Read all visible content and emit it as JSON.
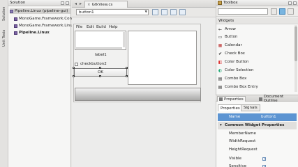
{
  "left_dock": {
    "tabs": [
      "Solution",
      "Unit Tests"
    ]
  },
  "solution": {
    "title": "Solution",
    "items": [
      {
        "label": "Pipeline.Linux (pipeline-gui)",
        "kind": "solution"
      },
      {
        "label": "MonoGame.Framework.Con",
        "kind": "project"
      },
      {
        "label": "MonoGame.Framework.Linu",
        "kind": "project"
      },
      {
        "label": "Pipeline.Linux",
        "kind": "project"
      }
    ]
  },
  "document": {
    "tab_label": "GtkView.cs",
    "widget_combo": "button1"
  },
  "designer": {
    "menu": [
      "File",
      "Edit",
      "Build",
      "Help"
    ],
    "label1": "label1",
    "checkbutton": "checkbutton2",
    "ok": "OK"
  },
  "toolbox": {
    "title": "Toolbox",
    "section": "Widgets",
    "items": [
      {
        "label": "Arrow",
        "icon": "arrow-icon",
        "glyph": "←"
      },
      {
        "label": "Button",
        "icon": "button-icon",
        "glyph": "▭"
      },
      {
        "label": "Calendar",
        "icon": "calendar-icon",
        "glyph": "▦"
      },
      {
        "label": "Check Box",
        "icon": "checkbox-icon",
        "glyph": "✔"
      },
      {
        "label": "Color Button",
        "icon": "color-button-icon",
        "glyph": "◧"
      },
      {
        "label": "Color Selection",
        "icon": "color-selection-icon",
        "glyph": "◐"
      },
      {
        "label": "Combo Box",
        "icon": "combo-box-icon",
        "glyph": "▤"
      },
      {
        "label": "Combo Box Entry",
        "icon": "combo-box-entry-icon",
        "glyph": "▤"
      }
    ]
  },
  "properties": {
    "tabs": [
      "Properties",
      "Document Outline"
    ],
    "subtabs": [
      "Properties",
      "Signals"
    ],
    "rows": [
      {
        "key": "Name",
        "value": "button1",
        "type": "selected"
      },
      {
        "key": "Common Widget Properties",
        "value": "",
        "type": "group"
      },
      {
        "key": "MemberName",
        "value": "",
        "type": "text"
      },
      {
        "key": "WidthRequest",
        "value": "",
        "type": "text"
      },
      {
        "key": "HeightRequest",
        "value": "",
        "type": "text"
      },
      {
        "key": "Visible",
        "value": "",
        "type": "check"
      },
      {
        "key": "Sensitive",
        "value": "",
        "type": "check"
      }
    ]
  }
}
